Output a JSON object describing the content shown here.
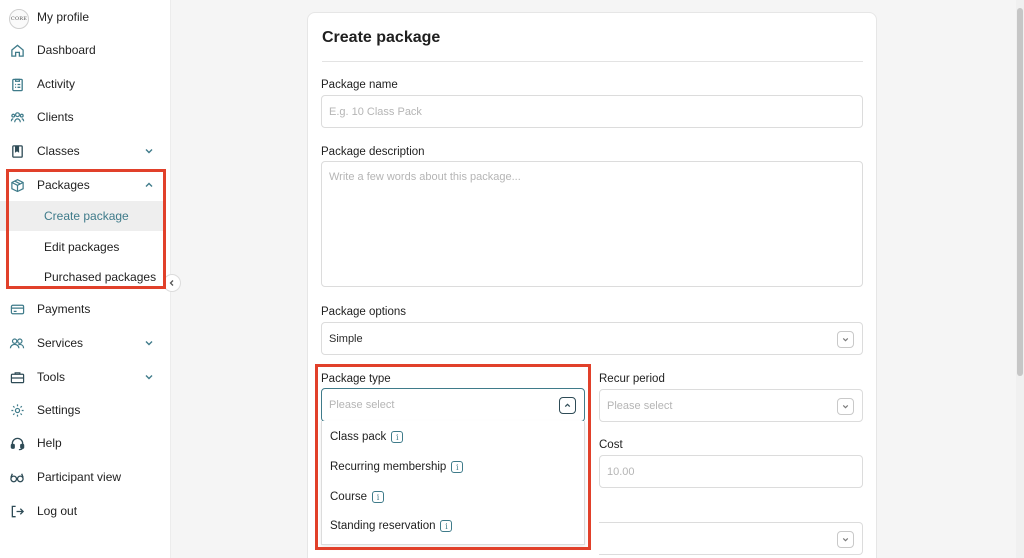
{
  "sidebar": {
    "logo_text": "CORE",
    "items": [
      {
        "label": "My profile"
      },
      {
        "label": "Dashboard"
      },
      {
        "label": "Activity"
      },
      {
        "label": "Clients"
      },
      {
        "label": "Classes"
      },
      {
        "label": "Packages"
      },
      {
        "label": "Payments"
      },
      {
        "label": "Services"
      },
      {
        "label": "Tools"
      },
      {
        "label": "Settings"
      },
      {
        "label": "Help"
      },
      {
        "label": "Participant view"
      },
      {
        "label": "Log out"
      }
    ],
    "packages_sub": [
      {
        "label": "Create package",
        "active": true
      },
      {
        "label": "Edit packages"
      },
      {
        "label": "Purchased packages"
      }
    ]
  },
  "form": {
    "title": "Create package",
    "package_name": {
      "label": "Package name",
      "placeholder": "E.g. 10 Class Pack"
    },
    "package_description": {
      "label": "Package description",
      "placeholder": "Write a few words about this package..."
    },
    "package_options": {
      "label": "Package options",
      "value": "Simple"
    },
    "package_type": {
      "label": "Package type",
      "placeholder": "Please select",
      "options": [
        "Class pack",
        "Recurring membership",
        "Course",
        "Standing reservation"
      ]
    },
    "recur_period": {
      "label": "Recur period",
      "placeholder": "Please select"
    },
    "cost": {
      "label": "Cost",
      "placeholder": "10.00"
    }
  },
  "colors": {
    "accent": "#3f7b8a",
    "annotation": "#e1402a"
  }
}
